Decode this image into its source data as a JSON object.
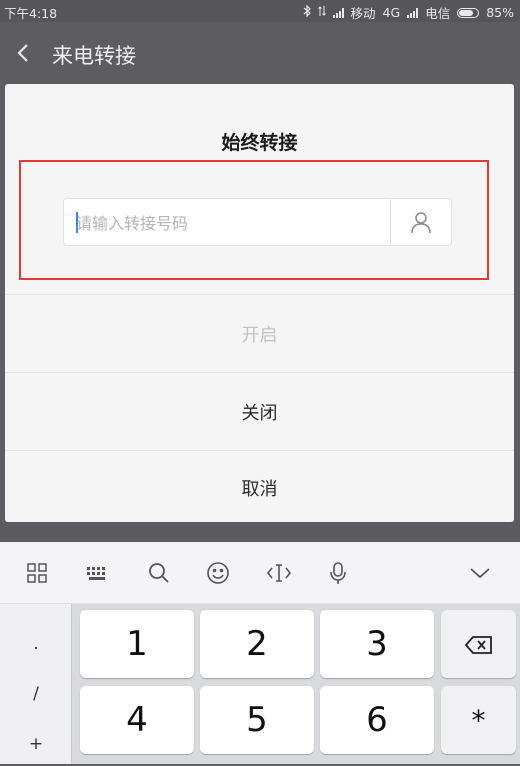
{
  "status_bar": {
    "time": "下午4:18",
    "carrier1": "移动",
    "network": "4G",
    "carrier2": "电信",
    "battery": "85%"
  },
  "header": {
    "title": "来电转接"
  },
  "dialog": {
    "title": "始终转接",
    "input_placeholder": "请输入转接号码",
    "buttons": [
      {
        "label": "开启",
        "enabled": false
      },
      {
        "label": "关闭",
        "enabled": true
      },
      {
        "label": "取消",
        "enabled": true
      }
    ]
  },
  "keyboard": {
    "toolbar_icons": [
      "grid-icon",
      "keyboard-icon",
      "search-icon",
      "emoji-icon",
      "cursor-icon",
      "microphone-icon",
      "collapse-icon"
    ],
    "symbols": [
      ".",
      "/",
      "+"
    ],
    "keys_row1": [
      "1",
      "2",
      "3"
    ],
    "keys_row2": [
      "4",
      "5",
      "6"
    ],
    "star": "*"
  },
  "colors": {
    "highlight": "#e53935",
    "caret": "#3f86e8"
  }
}
